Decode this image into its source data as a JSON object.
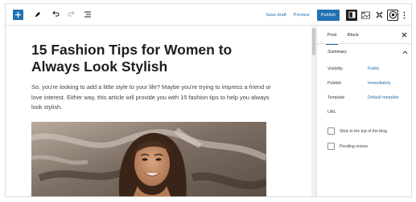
{
  "toolbar": {
    "add_icon": "plus-icon",
    "tools": [
      "pencil-icon",
      "undo-icon",
      "redo-icon",
      "list-view-icon"
    ],
    "save_draft": "Save draft",
    "preview": "Preview",
    "publish": "Publish",
    "right_icons": [
      "settings-panel-icon",
      "template-icon",
      "jetpack-icon",
      "yoast-icon",
      "more-options-icon"
    ]
  },
  "post": {
    "title": "15 Fashion Tips for Women to Always Look Stylish",
    "body": "So, you're looking to add a little style to your life? Maybe you're trying to impress a friend or love interest. Either way, this article will provide you with 15 fashion tips to help you always look stylish."
  },
  "sidebar": {
    "tabs": [
      "Post",
      "Block"
    ],
    "active_tab": "Post",
    "summary": {
      "heading": "Summary",
      "rows": [
        {
          "label": "Visibility",
          "value": "Public"
        },
        {
          "label": "Publish",
          "value": "Immediately"
        },
        {
          "label": "Template",
          "value": "Default template"
        },
        {
          "label": "URL",
          "value": ""
        }
      ],
      "checkboxes": [
        {
          "label": "Stick to the top of the blog",
          "checked": false
        },
        {
          "label": "Pending review",
          "checked": false
        }
      ]
    }
  },
  "colors": {
    "accent": "#2271b1",
    "text": "#1e1e1e"
  }
}
